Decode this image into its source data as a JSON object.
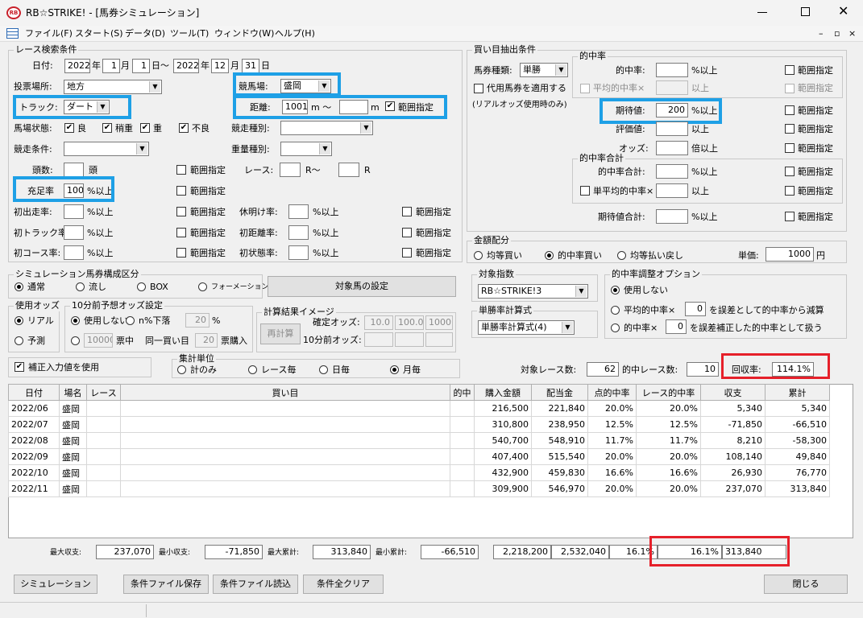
{
  "window": {
    "title": "RB☆STRIKE! - [馬券シミュレーション]",
    "logo_text": "RB"
  },
  "menu": [
    "ファイル(F)",
    "スタート(S)",
    "データ(D)",
    "ツール(T)",
    "ウィンドウ(W)",
    "ヘルプ(H)"
  ],
  "race_search": {
    "group_label": "レース検索条件",
    "date_label": "日付:",
    "from": {
      "year": "2022",
      "month": "1",
      "day": "1"
    },
    "to": {
      "year": "2022",
      "month": "12",
      "day": "31"
    },
    "year_unit": "年",
    "month_unit": "月",
    "day_unit": "日",
    "tilde": "日〜",
    "venue_label": "投票場所:",
    "venue_value": "地方",
    "track_course_label": "競馬場:",
    "track_course_value": "盛岡",
    "track_label": "トラック:",
    "track_value": "ダート",
    "distance_label": "距離:",
    "distance_from": "1001",
    "distance_unit_m1": "m 〜",
    "distance_to": "",
    "distance_unit_m2": "m",
    "range_label": "範囲指定",
    "condition_label": "馬場状態:",
    "conditions": [
      "良",
      "稍重",
      "重",
      "不良"
    ],
    "race_type_label": "競走種別:",
    "race_cond_label": "競走条件:",
    "weight_label": "重量種別:",
    "heads_label": "頭数:",
    "heads_unit": "頭",
    "race_label": "レース:",
    "race_unit1": "R〜",
    "race_unit2": "R",
    "fill_rate_label": "充足率",
    "fill_rate_value": "100",
    "pct_over": "%以上",
    "first_run_label": "初出走率:",
    "rest_label": "休明け率:",
    "first_track_label": "初トラック率:",
    "first_dist_label": "初距離率:",
    "first_course_label": "初コース率:",
    "first_state_label": "初状態率:"
  },
  "sim_type": {
    "group_label": "シミュレーション馬券構成区分",
    "options": [
      "通常",
      "流し",
      "BOX",
      "フォーメーション"
    ],
    "target_button": "対象馬の設定"
  },
  "odds_use": {
    "group_label": "使用オッズ",
    "options": [
      "リアル",
      "予測"
    ]
  },
  "odds10": {
    "group_label": "10分前予想オッズ設定",
    "opt1": "使用しない",
    "opt2": "n%下落",
    "pct_value": "20",
    "pct_unit": "%",
    "votes_value": "10000",
    "votes_unit": "票中",
    "same_label": "同一買い目",
    "same_value": "20",
    "same_unit": "票購入"
  },
  "calc_image": {
    "group_label": "計算結果イメージ",
    "recalc": "再計算",
    "fixed_label": "確定オッズ:",
    "fixed_values": [
      "10.0",
      "100.0",
      "1000"
    ],
    "before_label": "10分前オッズ:"
  },
  "correction": {
    "label": "補正入力値を使用"
  },
  "aggregate": {
    "group_label": "集計単位",
    "options": [
      "計のみ",
      "レース毎",
      "日毎",
      "月毎"
    ]
  },
  "buy_extract": {
    "group_label": "買い目抽出条件",
    "ticket_label": "馬券種類:",
    "ticket_value": "単勝",
    "substitute_label": "代用馬券を適用する",
    "real_odds_note": "(リアルオッズ使用時のみ)",
    "hit_group": "的中率",
    "hit_label": "的中率:",
    "avg_hit_label": "平均的中率×",
    "over": "以上",
    "expect_label": "期待値:",
    "expect_value": "200",
    "pct_over": "%以上",
    "eval_label": "評価値:",
    "odds_label": "オッズ:",
    "odds_over": "倍以上",
    "hit_sum_group": "的中率合計",
    "hit_sum_label": "的中率合計:",
    "single_avg_label": "単平均的中率×",
    "expect_sum_label": "期待値合計:",
    "range_label": "範囲指定"
  },
  "amount": {
    "group_label": "金額配分",
    "options": [
      "均等買い",
      "的中率買い",
      "均等払い戻し"
    ],
    "unit_label": "単価:",
    "unit_value": "1000",
    "yen": "円"
  },
  "target_index": {
    "group_label": "対象指数",
    "value": "RB☆STRIKE!3"
  },
  "win_rate_formula": {
    "group_label": "単勝率計算式",
    "value": "単勝率計算式(4)"
  },
  "hit_adjust": {
    "group_label": "的中率調整オプション",
    "opt1": "使用しない",
    "opt2_a": "平均的中率×",
    "opt2_val": "0",
    "opt2_b": "を誤差として的中率から減算",
    "opt3_a": "的中率×",
    "opt3_val": "0",
    "opt3_b": "を誤差補正した的中率として扱う"
  },
  "summary": {
    "target_label": "対象レース数:",
    "target_value": "62",
    "hit_label": "的中レース数:",
    "hit_value": "10",
    "recovery_label": "回収率:",
    "recovery_value": "114.1%"
  },
  "table": {
    "headers": [
      "日付",
      "場名",
      "レース",
      "買い目",
      "的中",
      "購入金額",
      "配当金",
      "点的中率",
      "レース的中率",
      "収支",
      "累計"
    ],
    "rows": [
      [
        "2022/06",
        "盛岡",
        "",
        "",
        "",
        "216,500",
        "221,840",
        "20.0%",
        "20.0%",
        "5,340",
        "5,340"
      ],
      [
        "2022/07",
        "盛岡",
        "",
        "",
        "",
        "310,800",
        "238,950",
        "12.5%",
        "12.5%",
        "-71,850",
        "-66,510"
      ],
      [
        "2022/08",
        "盛岡",
        "",
        "",
        "",
        "540,700",
        "548,910",
        "11.7%",
        "11.7%",
        "8,210",
        "-58,300"
      ],
      [
        "2022/09",
        "盛岡",
        "",
        "",
        "",
        "407,400",
        "515,540",
        "20.0%",
        "20.0%",
        "108,140",
        "49,840"
      ],
      [
        "2022/10",
        "盛岡",
        "",
        "",
        "",
        "432,900",
        "459,830",
        "16.6%",
        "16.6%",
        "26,930",
        "76,770"
      ],
      [
        "2022/11",
        "盛岡",
        "",
        "",
        "",
        "309,900",
        "546,970",
        "20.0%",
        "20.0%",
        "237,070",
        "313,840"
      ]
    ]
  },
  "totals": {
    "max_label": "最大収支:",
    "max_value": "237,070",
    "min_label": "最小収支:",
    "min_value": "-71,850",
    "max_cum_label": "最大累計:",
    "max_cum_value": "313,840",
    "min_cum_label": "最小累計:",
    "min_cum_value": "-66,510",
    "buy_total": "2,218,200",
    "pay_total": "2,532,040",
    "point_hit": "16.1%",
    "race_hit": "16.1%",
    "cum_total": "313,840"
  },
  "buttons": {
    "simulate": "シミュレーション",
    "save": "条件ファイル保存",
    "load": "条件ファイル読込",
    "clear": "条件全クリア",
    "close": "閉じる"
  }
}
